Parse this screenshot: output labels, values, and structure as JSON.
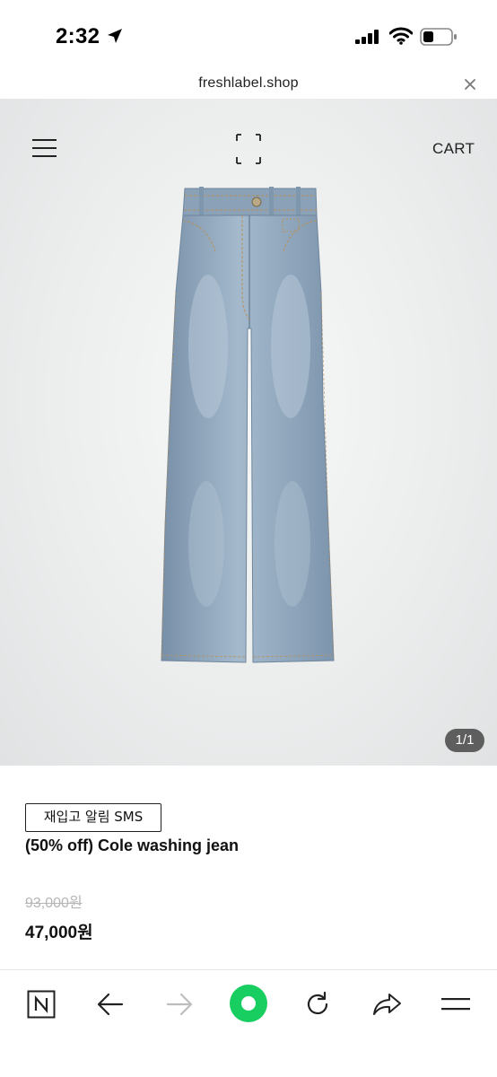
{
  "status_bar": {
    "time": "2:32",
    "icons": [
      "location-arrow-icon",
      "cellular-signal-icon",
      "wifi-icon",
      "battery-icon"
    ]
  },
  "browser": {
    "url": "freshlabel.shop",
    "close_icon": "close-icon"
  },
  "header": {
    "menu_icon": "hamburger-menu-icon",
    "logo_icon": "bracket-logo-icon",
    "cart_label": "CART"
  },
  "gallery": {
    "counter": "1/1",
    "image": "jeans-product-image"
  },
  "product": {
    "restock_button": "재입고 알림 SMS",
    "name": "(50% off) Cole washing jean",
    "original_price": "93,000원",
    "sale_price": "47,000원"
  },
  "toolbar": {
    "items": [
      "naver-home-icon",
      "back-arrow-icon",
      "forward-arrow-icon",
      "green-record-icon",
      "reload-icon",
      "share-icon",
      "more-menu-icon"
    ]
  },
  "colors": {
    "accent_green": "#19ce60",
    "denim": "#8fa7bd",
    "strike_gray": "#b5b5b5"
  }
}
